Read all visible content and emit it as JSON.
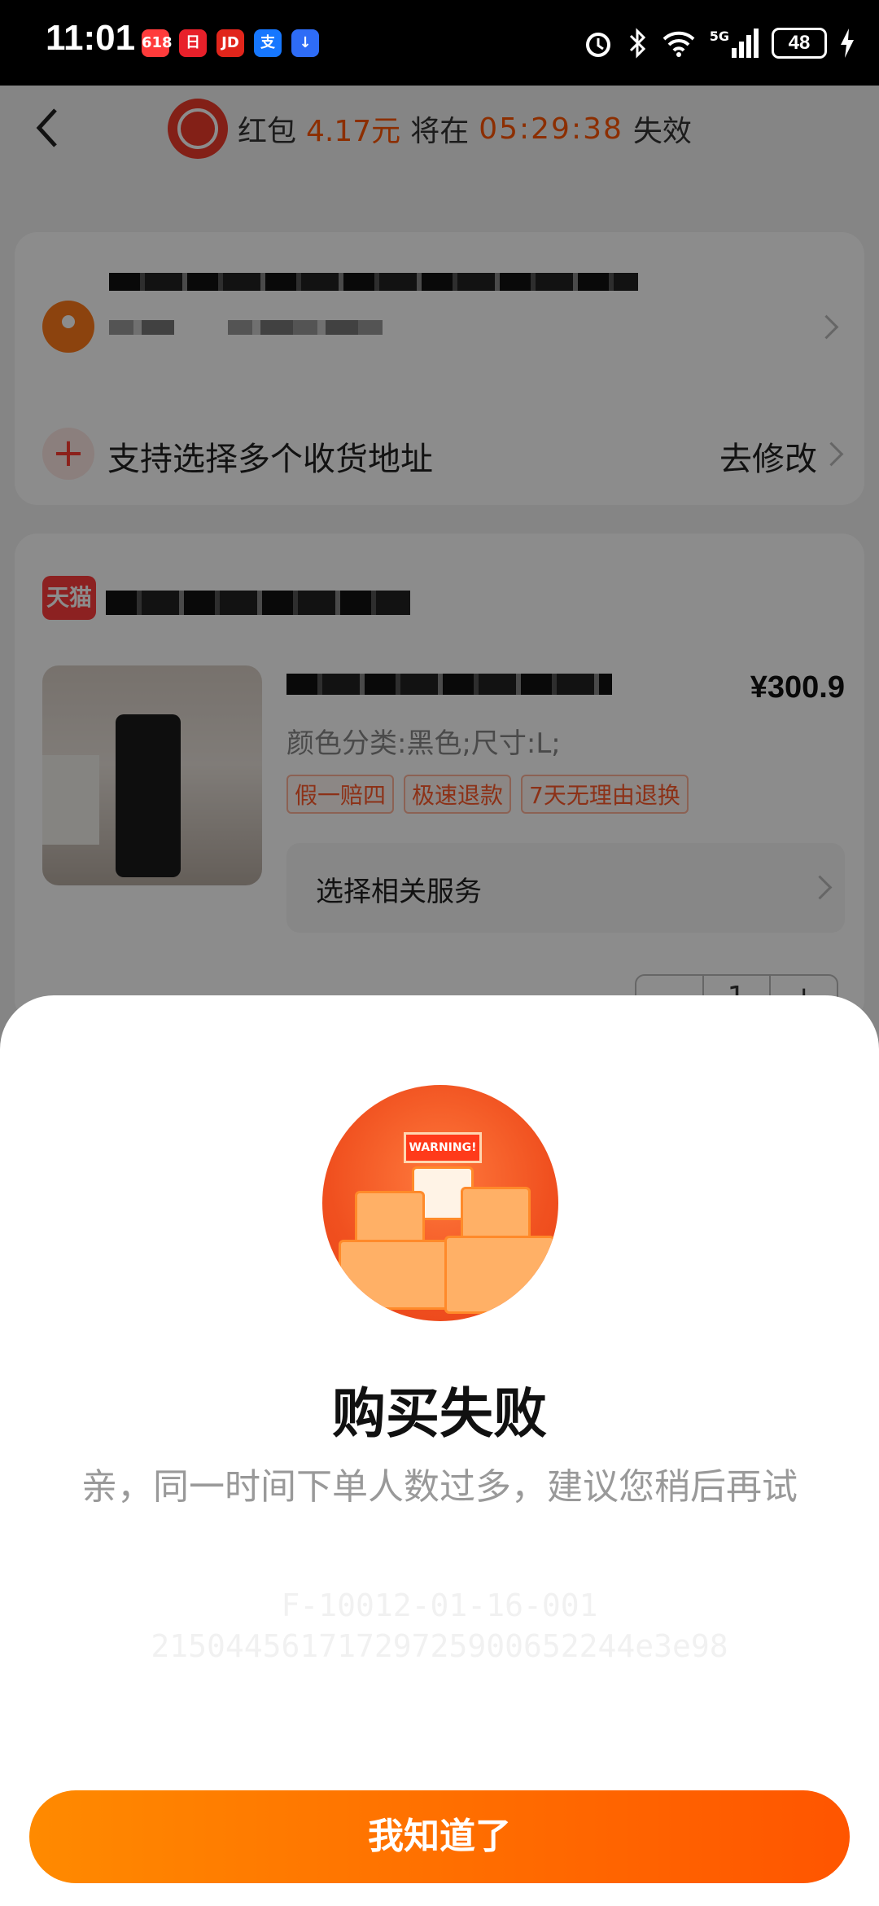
{
  "status_bar": {
    "time": "11:01",
    "network": "5G",
    "battery": "48",
    "apps": [
      {
        "icon": "app-red-icon",
        "label": "618",
        "color": "#ff3b3b"
      },
      {
        "icon": "app-calendar-icon",
        "label": "日",
        "color": "#e8202a"
      },
      {
        "icon": "app-jd-icon",
        "label": "JD",
        "color": "#e1251b"
      },
      {
        "icon": "alipay-icon",
        "label": "支",
        "color": "#1677ff"
      },
      {
        "icon": "app-blue-icon",
        "label": "↓",
        "color": "#2e6cf6"
      }
    ]
  },
  "header": {
    "red_packet_prefix": "红包",
    "red_packet_amount": "4.17元",
    "expire_prefix": "将在",
    "countdown": "05:29:38",
    "expire_suffix": "失效"
  },
  "address": {
    "multi_label": "支持选择多个收货地址",
    "edit_label": "去修改"
  },
  "shop": {
    "logo_label": "天猫",
    "product": {
      "price": "¥300.9",
      "spec": "颜色分类:黑色;尺寸:L;",
      "tags": [
        "假一赔四",
        "极速退款",
        "7天无理由退换"
      ],
      "service_label": "选择相关服务",
      "quantity": "1",
      "minus": "−",
      "plus": "+"
    }
  },
  "modal": {
    "warning_label": "WARNING!",
    "title": "购买失败",
    "message": "亲，同一时间下单人数过多，建议您稍后再试",
    "code_line1": "F-10012-01-16-001",
    "code_line2": "21504456171729725900652244e3e98",
    "button_label": "我知道了"
  },
  "colors": {
    "accent": "#ff5500",
    "button_start": "#ff8a00",
    "button_end": "#ff5500"
  }
}
